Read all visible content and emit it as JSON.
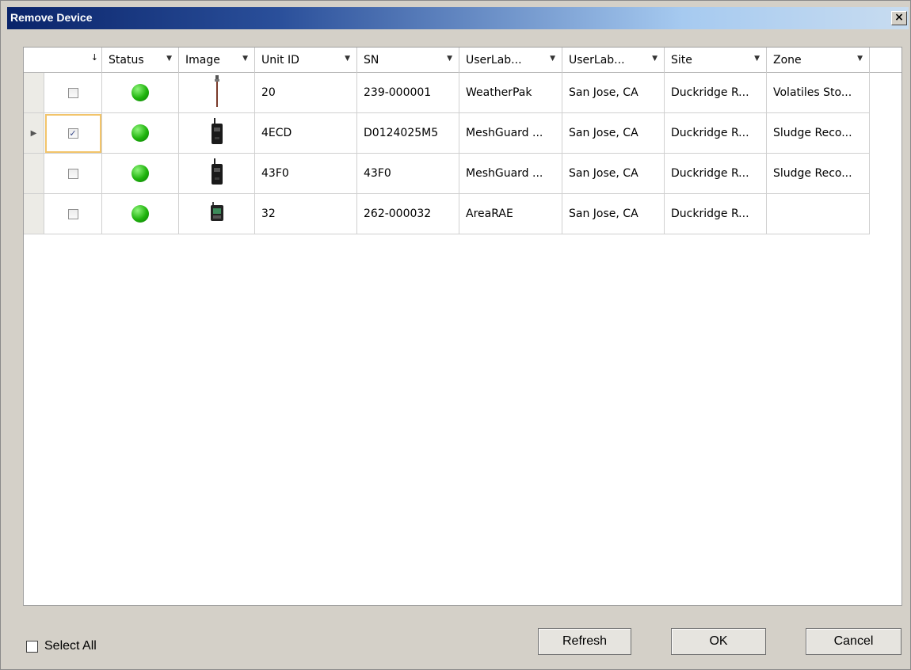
{
  "window": {
    "title": "Remove Device",
    "close_glyph": "×"
  },
  "columns": [
    {
      "label": "",
      "sort_glyph": "↓"
    },
    {
      "label": "Status"
    },
    {
      "label": "Image"
    },
    {
      "label": "Unit ID"
    },
    {
      "label": "SN"
    },
    {
      "label": "UserLab..."
    },
    {
      "label": "UserLab..."
    },
    {
      "label": "Site"
    },
    {
      "label": "Zone"
    }
  ],
  "rows": [
    {
      "checked": false,
      "current": false,
      "status_color": "#1fb30d",
      "image_icon": "weatherpak-device-icon",
      "unit_id": "20",
      "sn": "239-000001",
      "userlab1": "WeatherPak",
      "userlab2": "San Jose, CA",
      "site": "Duckridge R...",
      "zone": "Volatiles Sto..."
    },
    {
      "checked": true,
      "current": true,
      "status_color": "#1fb30d",
      "image_icon": "meshguard-device-icon",
      "unit_id": "4ECD",
      "sn": "D0124025M5",
      "userlab1": "MeshGuard ...",
      "userlab2": "San Jose, CA",
      "site": "Duckridge R...",
      "zone": "Sludge Reco..."
    },
    {
      "checked": false,
      "current": false,
      "status_color": "#1fb30d",
      "image_icon": "meshguard-device-icon",
      "unit_id": "43F0",
      "sn": "43F0",
      "userlab1": "MeshGuard ...",
      "userlab2": "San Jose, CA",
      "site": "Duckridge R...",
      "zone": "Sludge Reco..."
    },
    {
      "checked": false,
      "current": false,
      "status_color": "#1fb30d",
      "image_icon": "arearae-device-icon",
      "unit_id": "32",
      "sn": "262-000032",
      "userlab1": "AreaRAE",
      "userlab2": "San Jose, CA",
      "site": "Duckridge R...",
      "zone": ""
    }
  ],
  "footer": {
    "select_all_label": "Select All",
    "refresh_label": "Refresh",
    "ok_label": "OK",
    "cancel_label": "Cancel"
  }
}
